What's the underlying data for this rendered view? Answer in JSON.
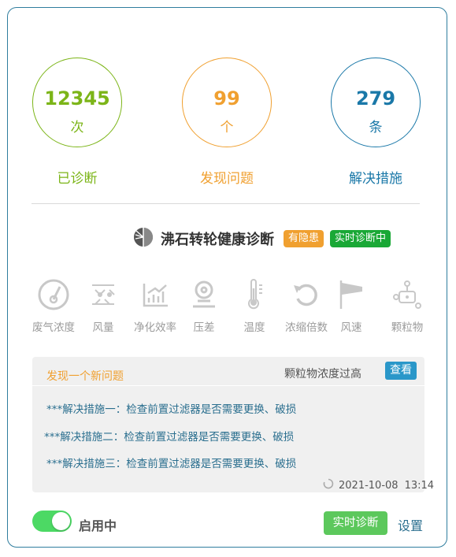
{
  "stats": [
    {
      "value": "12345",
      "unit": "次",
      "label": "已诊断",
      "color": "#7cb518"
    },
    {
      "value": "99",
      "unit": "个",
      "label": "发现问题",
      "color": "#f0a030"
    },
    {
      "value": "279",
      "unit": "条",
      "label": "解决措施",
      "color": "#1a78a8"
    }
  ],
  "header": {
    "title": "沸石转轮健康诊断",
    "badge_risk": "有隐患",
    "badge_risk_color": "#f0a030",
    "badge_realtime": "实时诊断中",
    "badge_realtime_color": "#1aa836"
  },
  "metrics": [
    {
      "label": "废气浓度",
      "icon": "gauge-icon"
    },
    {
      "label": "风量",
      "icon": "airflow-icon"
    },
    {
      "label": "净化效率",
      "icon": "bar-chart-icon"
    },
    {
      "label": "压差",
      "icon": "pressure-icon"
    },
    {
      "label": "温度",
      "icon": "thermometer-icon"
    },
    {
      "label": "浓缩倍数",
      "icon": "refresh-icon"
    },
    {
      "label": "风速",
      "icon": "windsock-icon"
    },
    {
      "label": "颗粒物",
      "icon": "particle-icon"
    }
  ],
  "problem": {
    "title": "发现一个新问题",
    "description": "颗粒物浓度过高",
    "view_button": "查看",
    "measures": [
      "***解决措施一：检查前置过滤器是否需要更换、破损",
      "***解决措施二：检查前置过滤器是否需要更换、破损",
      "***解决措施三：检查前置过滤器是否需要更换、破损"
    ],
    "date": "2021-10-08",
    "time": "13:14"
  },
  "footer": {
    "toggle_on": true,
    "toggle_label": "启用中",
    "realtime_button": "实时诊断",
    "settings_link": "设置"
  }
}
